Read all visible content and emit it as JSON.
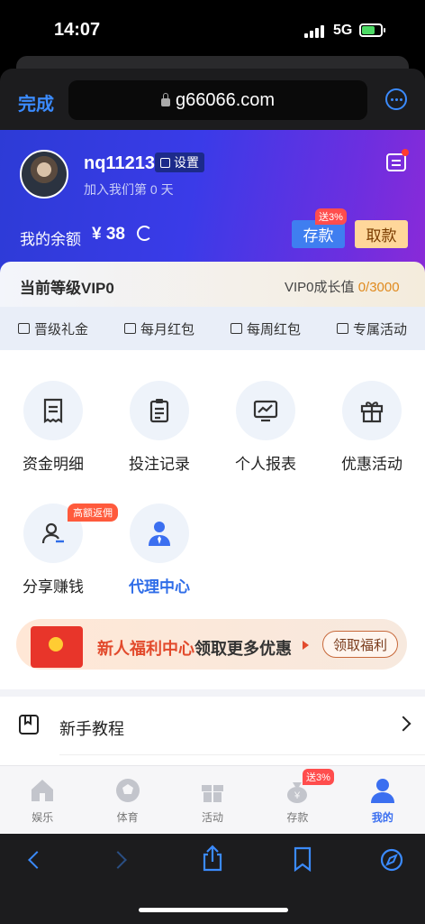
{
  "status": {
    "time": "14:07",
    "network": "5G"
  },
  "browser": {
    "done_label": "完成",
    "url": "g66066.com"
  },
  "user": {
    "name": "nq11213",
    "settings_label": "设置",
    "joined": "加入我们第 0 天",
    "balance_label": "我的余额",
    "balance_value": "¥ 38",
    "deposit_label": "存款",
    "deposit_badge": "送3%",
    "withdraw_label": "取款"
  },
  "vip": {
    "level": "当前等级VIP0",
    "growth_label": "VIP0成长值",
    "growth_current": "0",
    "growth_total": "/3000",
    "nav": [
      {
        "label": "晋级礼金",
        "icon": "gift-icon"
      },
      {
        "label": "每月红包",
        "icon": "envelope-icon"
      },
      {
        "label": "每周红包",
        "icon": "bag-icon"
      },
      {
        "label": "专属活动",
        "icon": "star-card-icon"
      }
    ]
  },
  "grid": [
    {
      "label": "资金明细",
      "icon": "receipt-icon"
    },
    {
      "label": "投注记录",
      "icon": "clipboard-icon"
    },
    {
      "label": "个人报表",
      "icon": "chart-monitor-icon"
    },
    {
      "label": "优惠活动",
      "icon": "gift-box-icon"
    },
    {
      "label": "分享赚钱",
      "icon": "share-user-icon"
    },
    {
      "label": "代理中心",
      "icon": "agent-icon"
    }
  ],
  "share_badge": "高额返佣",
  "banner": {
    "text_red": "新人福利中心",
    "text_dark": "领取更多优惠",
    "button": "领取福利"
  },
  "tutorial": {
    "label": "新手教程"
  },
  "tabs": [
    {
      "label": "娱乐",
      "icon": "home-icon"
    },
    {
      "label": "体育",
      "icon": "soccer-ball-icon"
    },
    {
      "label": "活动",
      "icon": "gift-icon"
    },
    {
      "label": "存款",
      "icon": "money-bag-icon"
    },
    {
      "label": "我的",
      "icon": "person-icon"
    }
  ],
  "tab_badge": "送3%",
  "colors": {
    "accent": "#3b6ff0",
    "hero_start": "#2d3bd6",
    "hero_end": "#8a2ad8",
    "red": "#ff4d4d"
  }
}
